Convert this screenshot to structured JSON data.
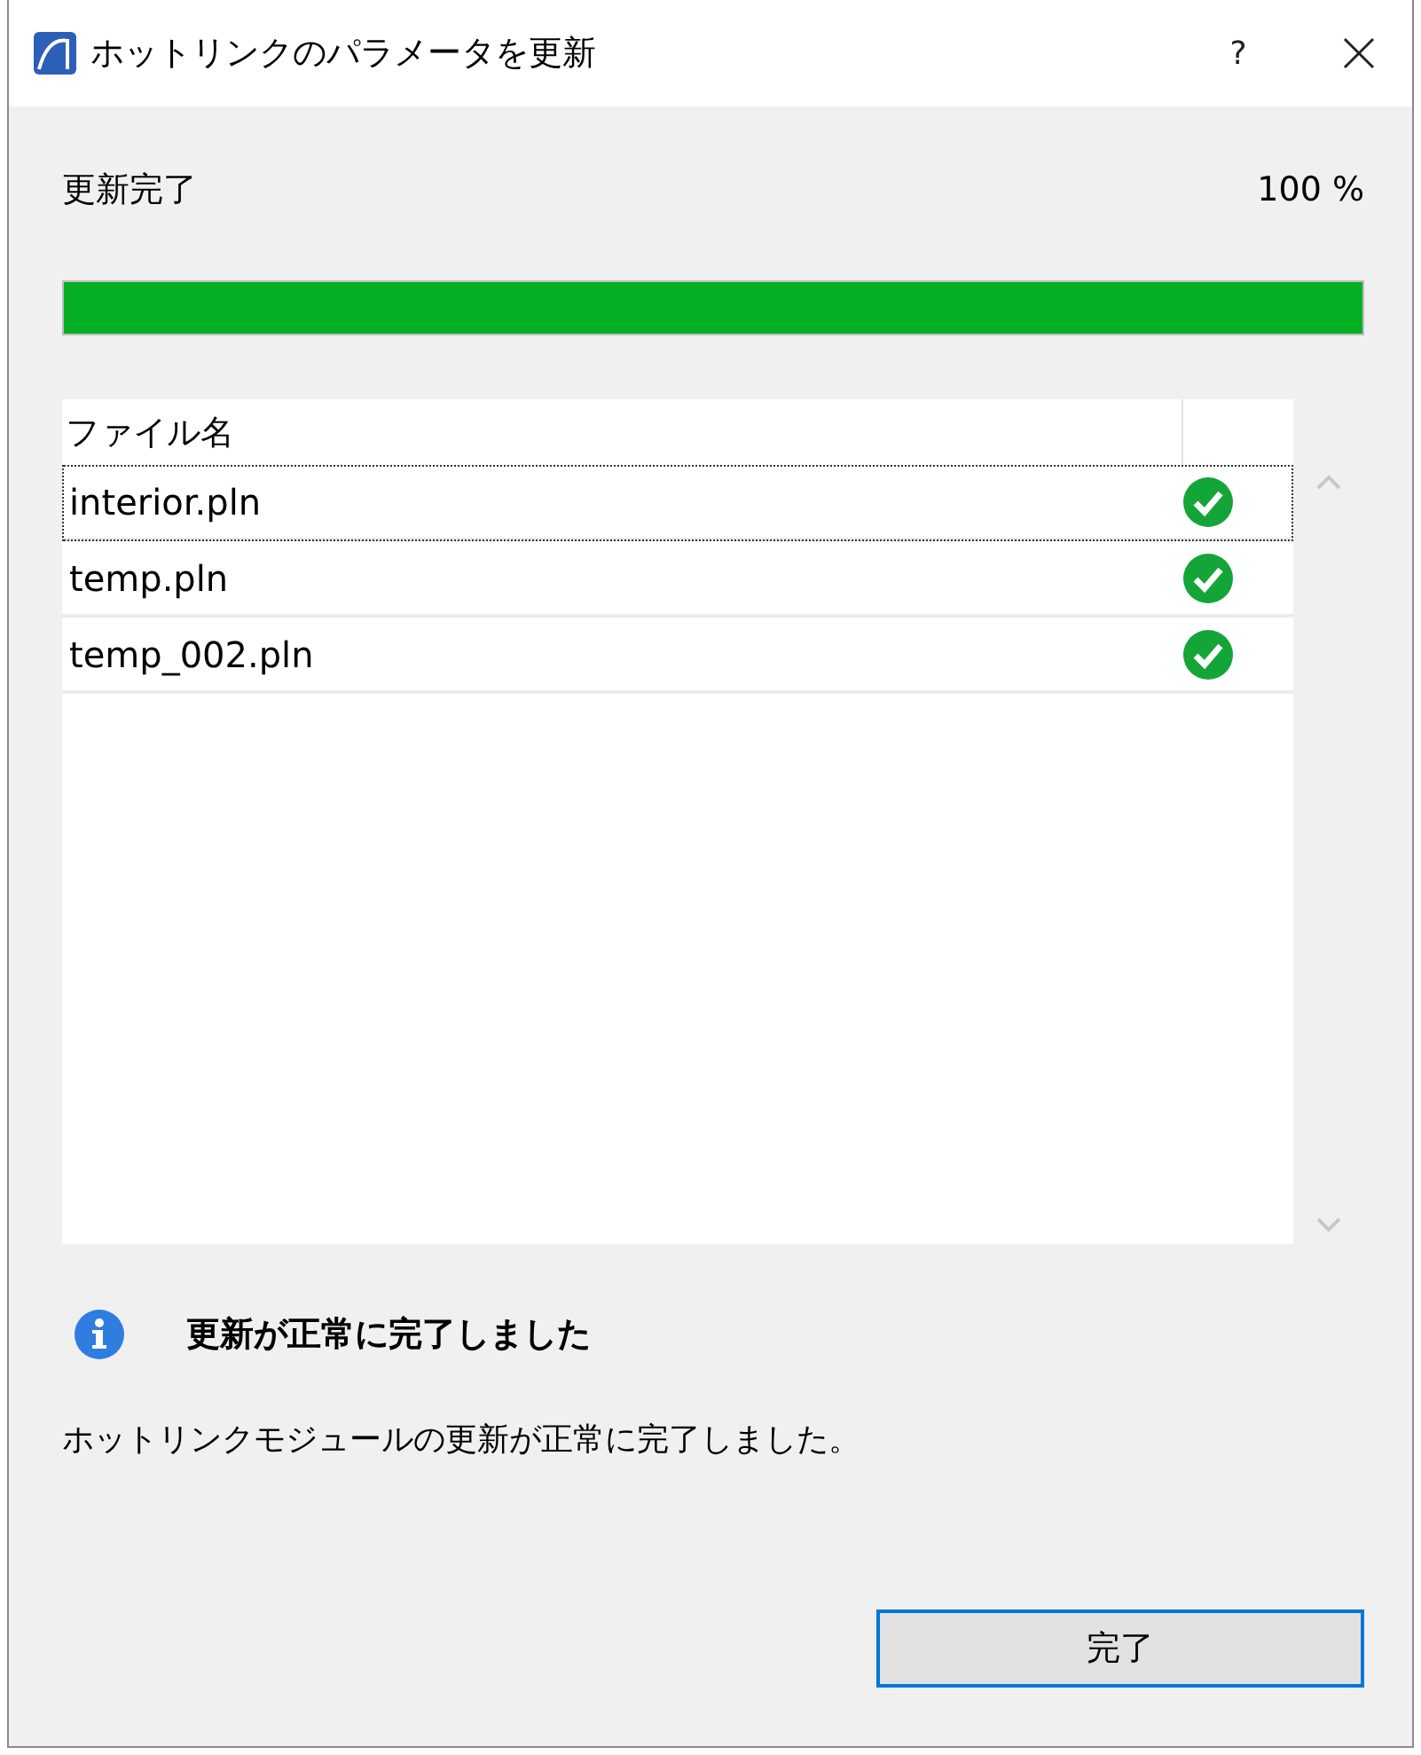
{
  "window": {
    "title": "ホットリンクのパラメータを更新",
    "help_button": "?"
  },
  "progress": {
    "label": "更新完了",
    "percent": "100 %",
    "level": 1
  },
  "table": {
    "columns": [
      "ファイル名"
    ],
    "rows": [
      {
        "name": "interior.pln",
        "selected": true,
        "done": true
      },
      {
        "name": "temp.pln",
        "selected": false,
        "done": true
      },
      {
        "name": "temp_002.pln",
        "selected": false,
        "done": true
      }
    ]
  },
  "message": {
    "title": "更新が正常に完了しました",
    "body": "ホットリンクモジュールの更新が正常に完了しました。"
  },
  "buttons": [
    "完了"
  ]
}
